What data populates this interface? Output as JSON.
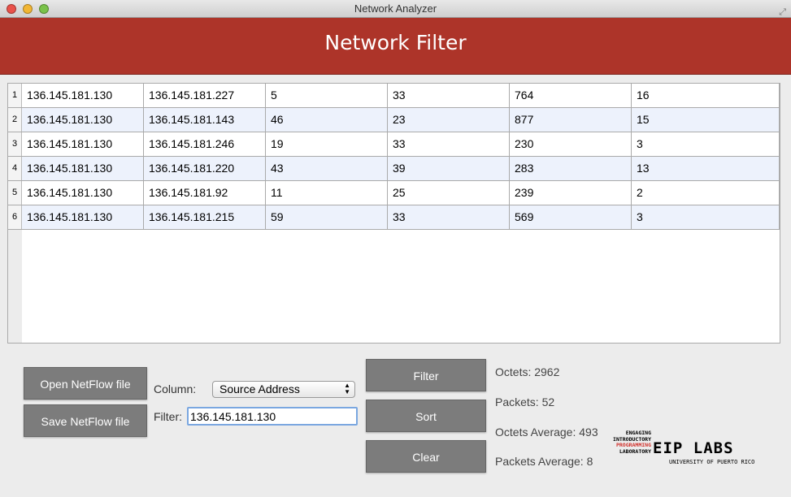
{
  "window": {
    "title": "Network Analyzer"
  },
  "header": {
    "title": "Network Filter"
  },
  "table": {
    "rows": [
      {
        "n": "1",
        "cells": [
          "136.145.181.130",
          "136.145.181.227",
          "5",
          "33",
          "764",
          "16"
        ]
      },
      {
        "n": "2",
        "cells": [
          "136.145.181.130",
          "136.145.181.143",
          "46",
          "23",
          "877",
          "15"
        ]
      },
      {
        "n": "3",
        "cells": [
          "136.145.181.130",
          "136.145.181.246",
          "19",
          "33",
          "230",
          "3"
        ]
      },
      {
        "n": "4",
        "cells": [
          "136.145.181.130",
          "136.145.181.220",
          "43",
          "39",
          "283",
          "13"
        ]
      },
      {
        "n": "5",
        "cells": [
          "136.145.181.130",
          "136.145.181.92",
          "11",
          "25",
          "239",
          "2"
        ]
      },
      {
        "n": "6",
        "cells": [
          "136.145.181.130",
          "136.145.181.215",
          "59",
          "33",
          "569",
          "3"
        ]
      }
    ]
  },
  "controls": {
    "open_label": "Open NetFlow file",
    "save_label": "Save NetFlow file",
    "column_label": "Column:",
    "column_value": "Source Address",
    "filter_label": "Filter:",
    "filter_value": "136.145.181.130",
    "filter_btn": "Filter",
    "sort_btn": "Sort",
    "clear_btn": "Clear"
  },
  "stats": {
    "octets": "Octets: 2962",
    "packets": "Packets: 52",
    "octets_avg": "Octets Average: 493",
    "packets_avg": "Packets Average: 8"
  },
  "logo": {
    "lines": [
      "ENGAGING",
      "INTRODUCTORY",
      "PROGRAMMING",
      "LABORATORY"
    ],
    "brand": "EIP LABS",
    "sub": "UNIVERSITY OF PUERTO RICO"
  },
  "colors": {
    "header": "#ad3429",
    "button": "#7c7c7c",
    "row_alt": "#edf2fc"
  }
}
